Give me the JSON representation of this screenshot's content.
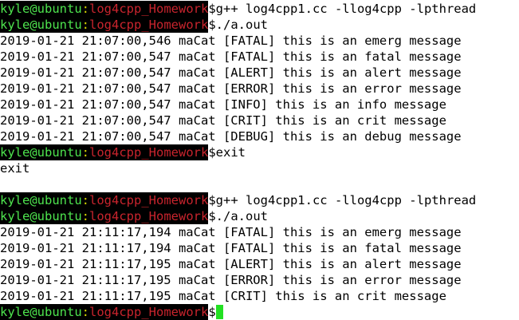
{
  "prompt": {
    "user_host": "kyle@ubuntu",
    "sep": ":",
    "dir": "log4cpp_Homework",
    "symbol": "$"
  },
  "colors": {
    "prompt_bg": "#000000",
    "user_host": "#4ee44e",
    "separator": "#d4d400",
    "directory": "#c8242d",
    "cursor": "#22e022",
    "text": "#000000",
    "background": "#ffffff"
  },
  "lines": [
    {
      "type": "prompt",
      "cmd": "g++ log4cpp1.cc -llog4cpp -lpthread"
    },
    {
      "type": "prompt",
      "cmd": "./a.out"
    },
    {
      "type": "output",
      "text": "2019-01-21 21:07:00,546 maCat [FATAL] this is an emerg message"
    },
    {
      "type": "output",
      "text": "2019-01-21 21:07:00,547 maCat [FATAL] this is an fatal message"
    },
    {
      "type": "output",
      "text": "2019-01-21 21:07:00,547 maCat [ALERT] this is an alert message"
    },
    {
      "type": "output",
      "text": "2019-01-21 21:07:00,547 maCat [ERROR] this is an error message"
    },
    {
      "type": "output",
      "text": "2019-01-21 21:07:00,547 maCat [INFO] this is an info message"
    },
    {
      "type": "output",
      "text": "2019-01-21 21:07:00,547 maCat [CRIT] this is an crit message"
    },
    {
      "type": "output",
      "text": "2019-01-21 21:07:00,547 maCat [DEBUG] this is an debug message"
    },
    {
      "type": "prompt",
      "cmd": "exit"
    },
    {
      "type": "output",
      "text": "exit"
    },
    {
      "type": "output",
      "text": ""
    },
    {
      "type": "prompt",
      "cmd": "g++ log4cpp1.cc -llog4cpp -lpthread"
    },
    {
      "type": "prompt",
      "cmd": "./a.out"
    },
    {
      "type": "output",
      "text": "2019-01-21 21:11:17,194 maCat [FATAL] this is an emerg message"
    },
    {
      "type": "output",
      "text": "2019-01-21 21:11:17,194 maCat [FATAL] this is an fatal message"
    },
    {
      "type": "output",
      "text": "2019-01-21 21:11:17,195 maCat [ALERT] this is an alert message"
    },
    {
      "type": "output",
      "text": "2019-01-21 21:11:17,195 maCat [ERROR] this is an error message"
    },
    {
      "type": "output",
      "text": "2019-01-21 21:11:17,195 maCat [CRIT] this is an crit message"
    },
    {
      "type": "prompt",
      "cmd": "",
      "cursor": true
    }
  ]
}
